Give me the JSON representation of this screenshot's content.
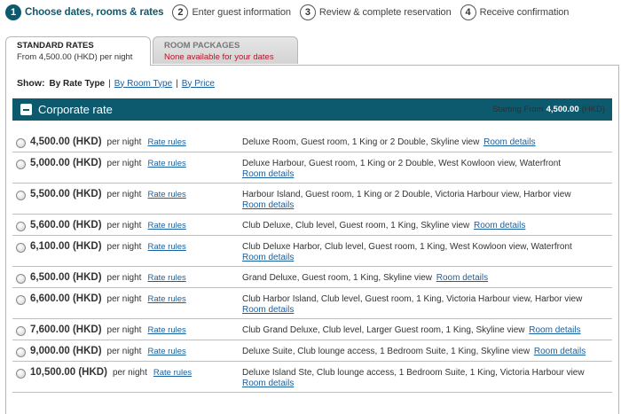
{
  "steps": [
    {
      "num": "1",
      "label": "Choose dates, rooms & rates",
      "active": true
    },
    {
      "num": "2",
      "label": "Enter guest information",
      "active": false
    },
    {
      "num": "3",
      "label": "Review & complete reservation",
      "active": false
    },
    {
      "num": "4",
      "label": "Receive confirmation",
      "active": false
    }
  ],
  "tabs": {
    "standard": {
      "title": "STANDARD RATES",
      "sub": "From 4,500.00 (HKD) per night"
    },
    "packages": {
      "title": "ROOM PACKAGES",
      "sub": "None available for your dates"
    }
  },
  "show": {
    "label": "Show:",
    "by_rate_type": "By Rate Type",
    "by_room_type": "By Room Type",
    "by_price": "By Price",
    "sep": "|"
  },
  "group": {
    "title": "Corporate rate",
    "starting_label": "Starting From",
    "starting_amount": "4,500.00",
    "starting_currency": "(HKD)"
  },
  "labels": {
    "per_night": "per night",
    "rate_rules": "Rate rules",
    "room_details": "Room details"
  },
  "rates": [
    {
      "price": "4,500.00 (HKD)",
      "desc": "Deluxe Room, Guest room, 1 King or 2 Double, Skyline view",
      "wrap": false
    },
    {
      "price": "5,000.00 (HKD)",
      "desc": "Deluxe Harbour, Guest room, 1 King or 2 Double, West Kowloon view, Waterfront",
      "wrap": true
    },
    {
      "price": "5,500.00 (HKD)",
      "desc": "Harbour Island, Guest room, 1 King or 2 Double, Victoria Harbour view, Harbor view",
      "wrap": true
    },
    {
      "price": "5,600.00 (HKD)",
      "desc": "Club Deluxe, Club level, Guest room, 1 King, Skyline view",
      "wrap": false
    },
    {
      "price": "6,100.00 (HKD)",
      "desc": "Club Deluxe Harbor, Club level, Guest room, 1 King, West Kowloon view, Waterfront",
      "wrap": true
    },
    {
      "price": "6,500.00 (HKD)",
      "desc": "Grand Deluxe, Guest room, 1 King, Skyline view",
      "wrap": false
    },
    {
      "price": "6,600.00 (HKD)",
      "desc": "Club Harbor Island, Club level, Guest room, 1 King, Victoria Harbour view, Harbor view",
      "wrap": true
    },
    {
      "price": "7,600.00 (HKD)",
      "desc": "Club Grand Deluxe, Club level, Larger Guest room, 1 King, Skyline view",
      "wrap": false
    },
    {
      "price": "9,000.00 (HKD)",
      "desc": "Deluxe Suite, Club lounge access, 1 Bedroom Suite, 1 King, Skyline view",
      "wrap": false
    },
    {
      "price": "10,500.00 (HKD)",
      "desc": "Deluxe Island Ste, Club lounge access, 1 Bedroom Suite, 1 King, Victoria Harbour view",
      "wrap": true
    }
  ]
}
